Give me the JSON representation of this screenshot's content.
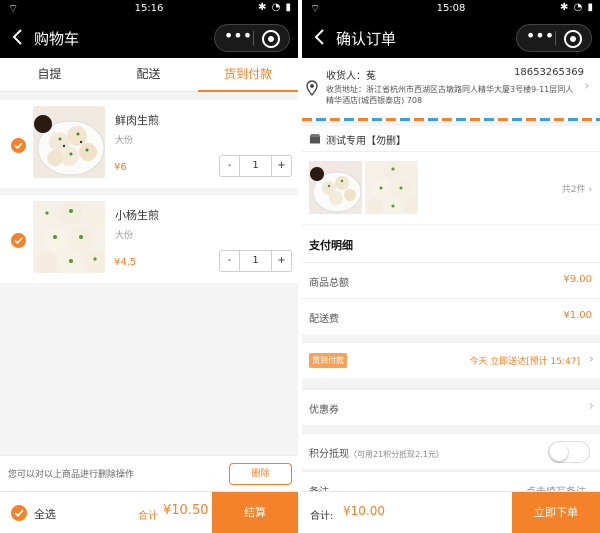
{
  "left": {
    "status": {
      "time": "15:16",
      "icons": "✱ ◔ ▮"
    },
    "nav": {
      "title": "购物车",
      "more": "•••"
    },
    "tabs": [
      {
        "label": "自提",
        "active": false
      },
      {
        "label": "配送",
        "active": false
      },
      {
        "label": "货到付款",
        "active": true
      }
    ],
    "items": [
      {
        "name": "鲜肉生煎",
        "spec": "大份",
        "price": "¥6",
        "qty": "1",
        "minus": "-",
        "plus": "+"
      },
      {
        "name": "小杨生煎",
        "spec": "大份",
        "price": "¥4.5",
        "qty": "1",
        "minus": "-",
        "plus": "+"
      }
    ],
    "hint": "您可以对以上商品进行删除操作",
    "delete_label": "删除",
    "footer": {
      "select_all": "全选",
      "total_label": "合计",
      "total": "¥10.50",
      "checkout": "结算"
    }
  },
  "right": {
    "status": {
      "time": "15:08",
      "icons": "✱ ◔ ▮"
    },
    "nav": {
      "title": "确认订单",
      "more": "•••"
    },
    "address": {
      "receiver": "收货人：菟",
      "phone": "18653265369",
      "full": "收货地址：浙江省杭州市西湖区古墩路同人精华大厦3号楼9-11层同人精华酒店(城西银泰店) 708"
    },
    "store": "测试专用【勿删】",
    "goods_count": "共2件",
    "pay_title": "支付明细",
    "rows": {
      "goods_total": {
        "label": "商品总额",
        "value": "¥9.00"
      },
      "delivery_fee": {
        "label": "配送费",
        "value": "¥1.00"
      },
      "payment": {
        "badge": "货到付款",
        "time": "今天 立即送达[预计 15:47]"
      },
      "coupon": {
        "label": "优惠券"
      },
      "points": {
        "label": "积分抵现",
        "sub": "（可用21积分抵现2.1元）",
        "enabled": false
      },
      "note": {
        "label": "备注",
        "placeholder": "点击填写备注"
      }
    },
    "footer": {
      "total_label": "合计:",
      "total": "¥10.00",
      "submit": "立即下单"
    }
  },
  "colors": {
    "accent": "#f3822a",
    "badge": "#f6a35a",
    "bar": "#000000"
  },
  "icons": [
    "back-icon",
    "more-icon",
    "close-circle-icon",
    "check-icon",
    "location-pin-icon",
    "store-icon",
    "chevron-right-icon",
    "wifi-icon"
  ]
}
